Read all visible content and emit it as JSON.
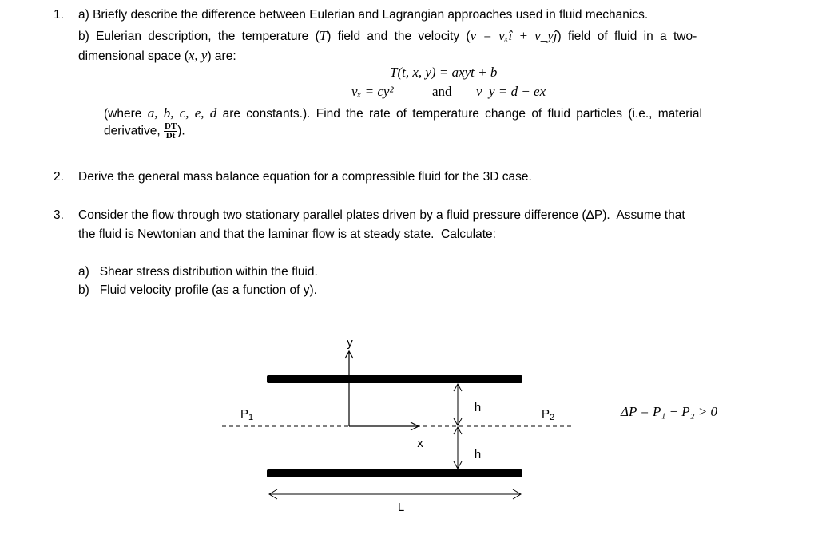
{
  "questions": [
    {
      "number": "1.",
      "parts": {
        "a": "a) Briefly describe the difference between Eulerian and Lagrangian approaches used in fluid mechanics.",
        "b_line1_start": "b) Eulerian description, the temperature (",
        "b_T": "T",
        "b_line1_mid": ") field and the velocity (",
        "b_velocity_eq": "v = vₓî + v_yĵ",
        "b_line1_end": ") field of fluid in a two-",
        "b_line2_start": "dimensional space (",
        "b_line2_vars": "x, y",
        "b_line2_end": ") are:",
        "equation_T": "T(t, x, y) = axyt + b",
        "equation_vx": "vₓ = cy²",
        "equation_and": "and",
        "equation_vy": "v_y = d − ex",
        "where_start": "(where ",
        "where_constants": "a, b, c, e, d",
        "where_end": " are constants.). Find the rate of temperature change of fluid particles (i.e., material",
        "derivative_label": "derivative, ",
        "derivative_num": "DT",
        "derivative_den": "Dt",
        "derivative_end": ")."
      }
    },
    {
      "number": "2.",
      "text": "Derive the general mass balance equation for a compressible fluid for the 3D case."
    },
    {
      "number": "3.",
      "line1": "Consider the flow through two stationary parallel plates driven by a fluid pressure difference (ΔP).  Assume that",
      "line2": "the fluid is Newtonian and that the laminar flow is at steady state.  Calculate:",
      "sub_a": "a)   Shear stress distribution within the fluid.",
      "sub_b": "b)   Fluid velocity profile (as a function of y)."
    }
  ],
  "diagram": {
    "label_y": "y",
    "label_x": "x",
    "label_h_top": "h",
    "label_h_bottom": "h",
    "label_P1": "P",
    "label_P1_sub": "1",
    "label_P2": "P",
    "label_P2_sub": "2",
    "label_L": "L",
    "pressure_relation": "ΔP = P₁ − P₂ > 0"
  }
}
